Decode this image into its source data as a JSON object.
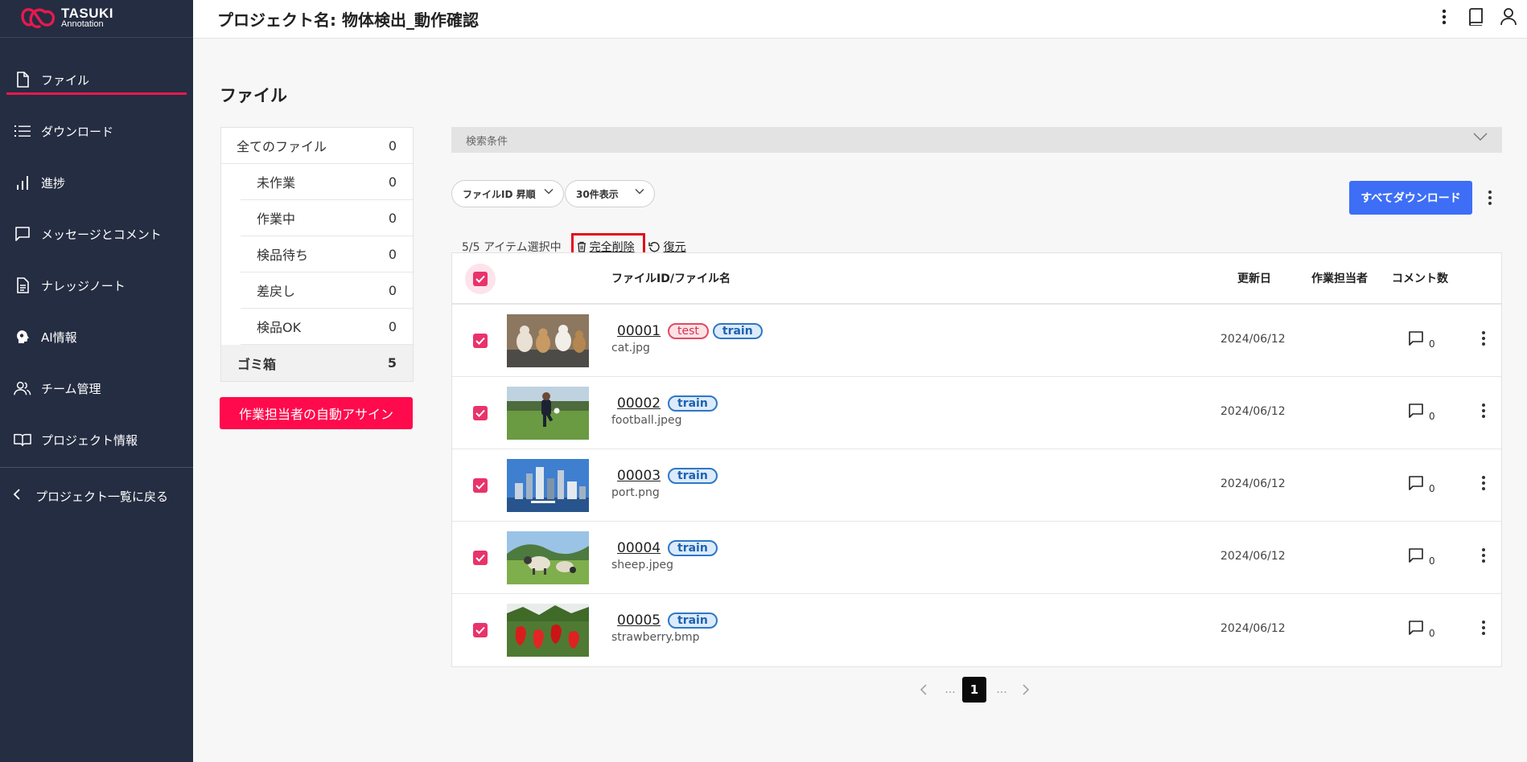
{
  "brand": {
    "line1": "TASUKI",
    "line2": "Annotation"
  },
  "sidebar": {
    "items": [
      {
        "label": "ファイル"
      },
      {
        "label": "ダウンロード"
      },
      {
        "label": "進捗"
      },
      {
        "label": "メッセージとコメント"
      },
      {
        "label": "ナレッジノート"
      },
      {
        "label": "AI情報"
      },
      {
        "label": "チーム管理"
      },
      {
        "label": "プロジェクト情報"
      }
    ],
    "back": "プロジェクト一覧に戻る"
  },
  "header": {
    "title": "プロジェクト名: 物体検出_動作確認"
  },
  "page": {
    "title": "ファイル"
  },
  "filters": [
    {
      "label": "全てのファイル",
      "count": "0"
    },
    {
      "label": "未作業",
      "count": "0"
    },
    {
      "label": "作業中",
      "count": "0"
    },
    {
      "label": "検品待ち",
      "count": "0"
    },
    {
      "label": "差戻し",
      "count": "0"
    },
    {
      "label": "検品OK",
      "count": "0"
    },
    {
      "label": "ゴミ箱",
      "count": "5"
    }
  ],
  "assign_button": "作業担当者の自動アサイン",
  "search": {
    "label": "検索条件"
  },
  "sort_select": "ファイルID 昇順",
  "per_page_select": "30件表示",
  "download_all": "すべてダウンロード",
  "selection": {
    "text": "5/5 アイテム選択中",
    "delete": "完全削除",
    "restore": "復元"
  },
  "table": {
    "headers": {
      "file": "ファイルID/ファイル名",
      "updated": "更新日",
      "assignee": "作業担当者",
      "comments": "コメント数"
    },
    "rows": [
      {
        "id": "00001",
        "name": "cat.jpg",
        "tags": [
          "test",
          "train"
        ],
        "date": "2024/06/12",
        "comments": "0"
      },
      {
        "id": "00002",
        "name": "football.jpeg",
        "tags": [
          "train"
        ],
        "date": "2024/06/12",
        "comments": "0"
      },
      {
        "id": "00003",
        "name": "port.png",
        "tags": [
          "train"
        ],
        "date": "2024/06/12",
        "comments": "0"
      },
      {
        "id": "00004",
        "name": "sheep.jpeg",
        "tags": [
          "train"
        ],
        "date": "2024/06/12",
        "comments": "0"
      },
      {
        "id": "00005",
        "name": "strawberry.bmp",
        "tags": [
          "train"
        ],
        "date": "2024/06/12",
        "comments": "0"
      }
    ]
  },
  "pagination": {
    "ellipsis": "...",
    "current": "1"
  },
  "colors": {
    "sidebar_bg": "#252d42",
    "accent": "#e8194f",
    "primary": "#3d6ef5",
    "highlight_box": "#e0101b"
  }
}
